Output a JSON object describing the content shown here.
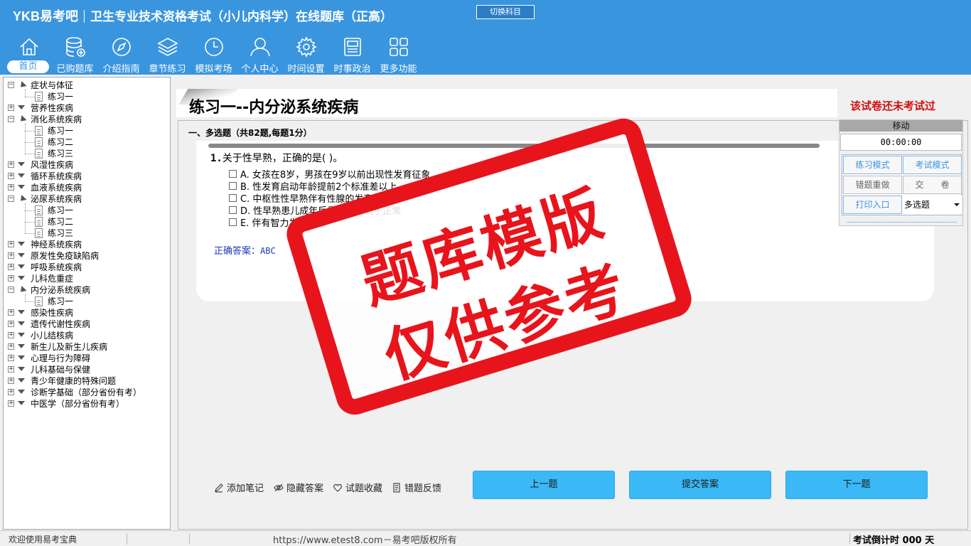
{
  "header": {
    "logo": "YKB易考吧",
    "title": "卫生专业技术资格考试（小儿内科学）在线题库（正高）",
    "switch_label": "切换科目",
    "nav": [
      {
        "label": "首页",
        "icon": "home-icon"
      },
      {
        "label": "已购题库",
        "icon": "database-add-icon"
      },
      {
        "label": "介绍指南",
        "icon": "compass-icon"
      },
      {
        "label": "章节练习",
        "icon": "layers-icon"
      },
      {
        "label": "模拟考场",
        "icon": "clock-icon"
      },
      {
        "label": "个人中心",
        "icon": "user-icon"
      },
      {
        "label": "时间设置",
        "icon": "gear-icon"
      },
      {
        "label": "时事政治",
        "icon": "news-icon"
      },
      {
        "label": "更多功能",
        "icon": "grid-icon"
      }
    ]
  },
  "tree": [
    {
      "label": "症状与体征",
      "expanded": true
    },
    {
      "label": "练习一",
      "leaf": true
    },
    {
      "label": "营养性疾病"
    },
    {
      "label": "消化系统疾病",
      "expanded": true
    },
    {
      "label": "练习一",
      "leaf": true
    },
    {
      "label": "练习二",
      "leaf": true
    },
    {
      "label": "练习三",
      "leaf": true
    },
    {
      "label": "风湿性疾病"
    },
    {
      "label": "循环系统疾病"
    },
    {
      "label": "血液系统疾病"
    },
    {
      "label": "泌尿系统疾病",
      "expanded": true
    },
    {
      "label": "练习一",
      "leaf": true
    },
    {
      "label": "练习二",
      "leaf": true
    },
    {
      "label": "练习三",
      "leaf": true
    },
    {
      "label": "神经系统疾病"
    },
    {
      "label": "原发性免疫缺陷病"
    },
    {
      "label": "呼吸系统疾病"
    },
    {
      "label": "儿科危重症"
    },
    {
      "label": "内分泌系统疾病",
      "expanded": true
    },
    {
      "label": "练习一",
      "leaf": true
    },
    {
      "label": "感染性疾病"
    },
    {
      "label": "遗传代谢性疾病"
    },
    {
      "label": "小儿结核病"
    },
    {
      "label": "新生儿及新生儿疾病"
    },
    {
      "label": "心理与行为障碍"
    },
    {
      "label": "儿科基础与保健"
    },
    {
      "label": "青少年健康的特殊问题"
    },
    {
      "label": "诊断学基础（部分省份有考）"
    },
    {
      "label": "中医学（部分省份有考）"
    }
  ],
  "content": {
    "title": "练习一--内分泌系统疾病",
    "status": "该试卷还未考试过",
    "section": "一、多选题（共82题,每题1分）",
    "question": {
      "number": "1.",
      "stem": "关于性早熟，正确的是( )。",
      "options": [
        "A. 女孩在8岁，男孩在9岁以前出现性发育征象",
        "B. 性发育启动年龄提前2个标准差以上",
        "C. 中枢性性早熟伴有性腺的发育",
        "D. 性早熟患儿成年后最终身高高于正常",
        "E. 伴有智力发育异常"
      ],
      "answer_label": "正确答案：",
      "answer_value": "ABC"
    },
    "tools": [
      "添加笔记",
      "隐藏答案",
      "试题收藏",
      "错题反馈"
    ],
    "buttons": {
      "prev": "上一题",
      "submit": "提交答案",
      "next": "下一题"
    }
  },
  "panel": {
    "head": "移动",
    "timer": "00:00:00",
    "practice_mode": "练习模式",
    "exam_mode": "考试模式",
    "redo_wrong": "错题重做",
    "hand_in": "交　　卷",
    "print": "打印入口",
    "type_select": "多选题"
  },
  "watermark": {
    "line1": "题库模版",
    "line2": "仅供参考"
  },
  "statusbar": {
    "welcome": "欢迎使用易考宝典",
    "copyright": "https://www.etest8.com－易考吧版权所有",
    "countdown": "考试倒计时 000 天"
  },
  "colors": {
    "header": "#3a95df",
    "button": "#3ab9f6",
    "status_red": "#d01010",
    "stamp_red": "#e8141c"
  }
}
